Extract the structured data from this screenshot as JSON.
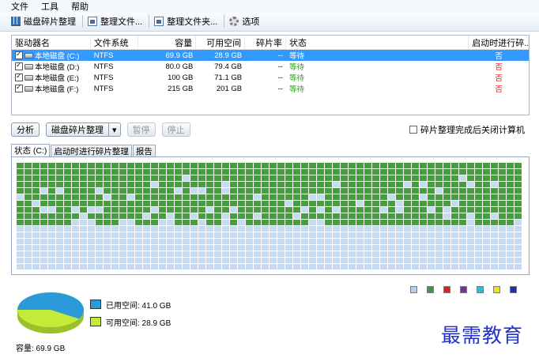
{
  "menu": {
    "file": "文件",
    "tools": "工具",
    "help": "帮助"
  },
  "toolbar": {
    "defrag": "磁盘碎片整理",
    "defrag_files": "整理文件...",
    "defrag_folders": "整理文件夹...",
    "options": "选项"
  },
  "drive_table": {
    "headers": {
      "drive": "驱动器名",
      "filesystem": "文件系统",
      "capacity": "容量",
      "free": "可用空间",
      "fragmentation": "碎片率",
      "status": "状态",
      "boot_defrag": "启动时进行碎..."
    },
    "rows": [
      {
        "name": "本地磁盘 (C:)",
        "fs": "NTFS",
        "capacity": "69.9 GB",
        "free": "28.9 GB",
        "frag": "--",
        "status": "等待",
        "boot": "否",
        "checked": true,
        "selected": true
      },
      {
        "name": "本地磁盘 (D:)",
        "fs": "NTFS",
        "capacity": "80.0 GB",
        "free": "79.4 GB",
        "frag": "--",
        "status": "等待",
        "boot": "否",
        "checked": true,
        "selected": false
      },
      {
        "name": "本地磁盘 (E:)",
        "fs": "NTFS",
        "capacity": "100 GB",
        "free": "71.1 GB",
        "frag": "--",
        "status": "等待",
        "boot": "否",
        "checked": true,
        "selected": false
      },
      {
        "name": "本地磁盘 (F:)",
        "fs": "NTFS",
        "capacity": "215 GB",
        "free": "201 GB",
        "frag": "--",
        "status": "等待",
        "boot": "否",
        "checked": true,
        "selected": false
      }
    ]
  },
  "actions": {
    "analyze": "分析",
    "defrag": "磁盘碎片整理",
    "pause": "暂停",
    "stop": "停止",
    "shutdown_label": "碎片整理完成后关闭计算机"
  },
  "tabs": [
    {
      "label": "状态 (C:)"
    },
    {
      "label": "启动时进行碎片整理"
    },
    {
      "label": "报告"
    }
  ],
  "legend_colors": [
    "#b8cfe8",
    "#3c9a3c",
    "#d9232b",
    "#7b2ca0",
    "#22c4d4",
    "#f2e400",
    "#1d2fa8"
  ],
  "cluster_map": {
    "used_color": "#4a9c43",
    "free_color": "#c6dbf0",
    "used_fraction": 0.587
  },
  "pie": {
    "used_label": "已用空间: 41.0 GB",
    "free_label": "可用空间: 28.9 GB",
    "used_gb": 41.0,
    "free_gb": 28.9,
    "used_color": "#2a9ad8",
    "free_color": "#c4ea3a"
  },
  "capacity_label": "容量: 69.9 GB",
  "watermark": "最需教育"
}
